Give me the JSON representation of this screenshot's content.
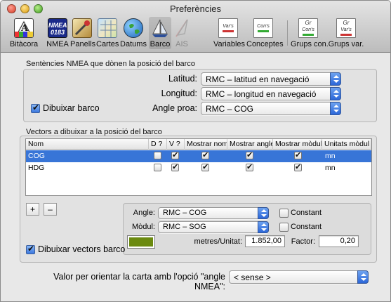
{
  "window": {
    "title": "Preferències"
  },
  "toolbar": {
    "items": [
      {
        "label": "Bitàcora",
        "icon": "logbook-icon"
      },
      {
        "label": "NMEA",
        "icon": "nmea-icon"
      },
      {
        "label": "Panells",
        "icon": "panels-icon"
      },
      {
        "label": "Cartes",
        "icon": "charts-icon"
      },
      {
        "label": "Datums",
        "icon": "globe-icon"
      },
      {
        "label": "Barco",
        "icon": "boat-icon"
      },
      {
        "label": "AIS",
        "icon": "ais-icon"
      },
      {
        "label": "Variables",
        "icon": "variables-icon",
        "doc": "Var's"
      },
      {
        "label": "Conceptes",
        "icon": "concepts-icon",
        "doc": "Con's"
      },
      {
        "label": "Grups con.",
        "icon": "concept-groups-icon",
        "doc_top": "Gr",
        "doc": "Con's"
      },
      {
        "label": "Grups var.",
        "icon": "variable-groups-icon",
        "doc_top": "Gr",
        "doc": "Var's"
      }
    ],
    "selected": "Barco"
  },
  "nmea_box": {
    "title": "Sentències NMEA que dònen la posició del barco",
    "latitude_label": "Latitud:",
    "latitude_value": "RMC – latitud en navegació",
    "longitude_label": "Longitud:",
    "longitude_value": "RMC – longitud en navegació",
    "heading_label": "Angle proa:",
    "heading_value": "RMC – COG",
    "draw_boat_label": "Dibuixar barco",
    "draw_boat_checked": true
  },
  "vectors_box": {
    "title": "Vectors a dibuixar a la posició del barco",
    "columns": [
      "Nom",
      "D ?",
      "V ?",
      "Mostrar nom",
      "Mostrar angle",
      "Mostrar mòdul",
      "Unitats mòdul"
    ],
    "rows": [
      {
        "name": "COG",
        "d": false,
        "v": true,
        "show_name": true,
        "show_angle": true,
        "show_module": true,
        "units": "mn",
        "selected": true
      },
      {
        "name": "HDG",
        "d": false,
        "v": true,
        "show_name": true,
        "show_angle": true,
        "show_module": true,
        "units": "mn",
        "selected": false
      }
    ],
    "add_label": "+",
    "remove_label": "–",
    "angle_label": "Angle:",
    "angle_value": "RMC – COG",
    "angle_constant_label": "Constant",
    "module_label": "Mòdul:",
    "module_value": "RMC – SOG",
    "module_constant_label": "Constant",
    "vector_color": "#6b8a10",
    "meters_label": "metres/Unitat:",
    "meters_value": "1.852,00",
    "factor_label": "Factor:",
    "factor_value": "0,20",
    "draw_vectors_label": "Dibuixar vectors barco",
    "draw_vectors_checked": true
  },
  "orient": {
    "label": "Valor per orientar la carta amb l'opció \"angle NMEA\":",
    "value": "< sense >"
  }
}
